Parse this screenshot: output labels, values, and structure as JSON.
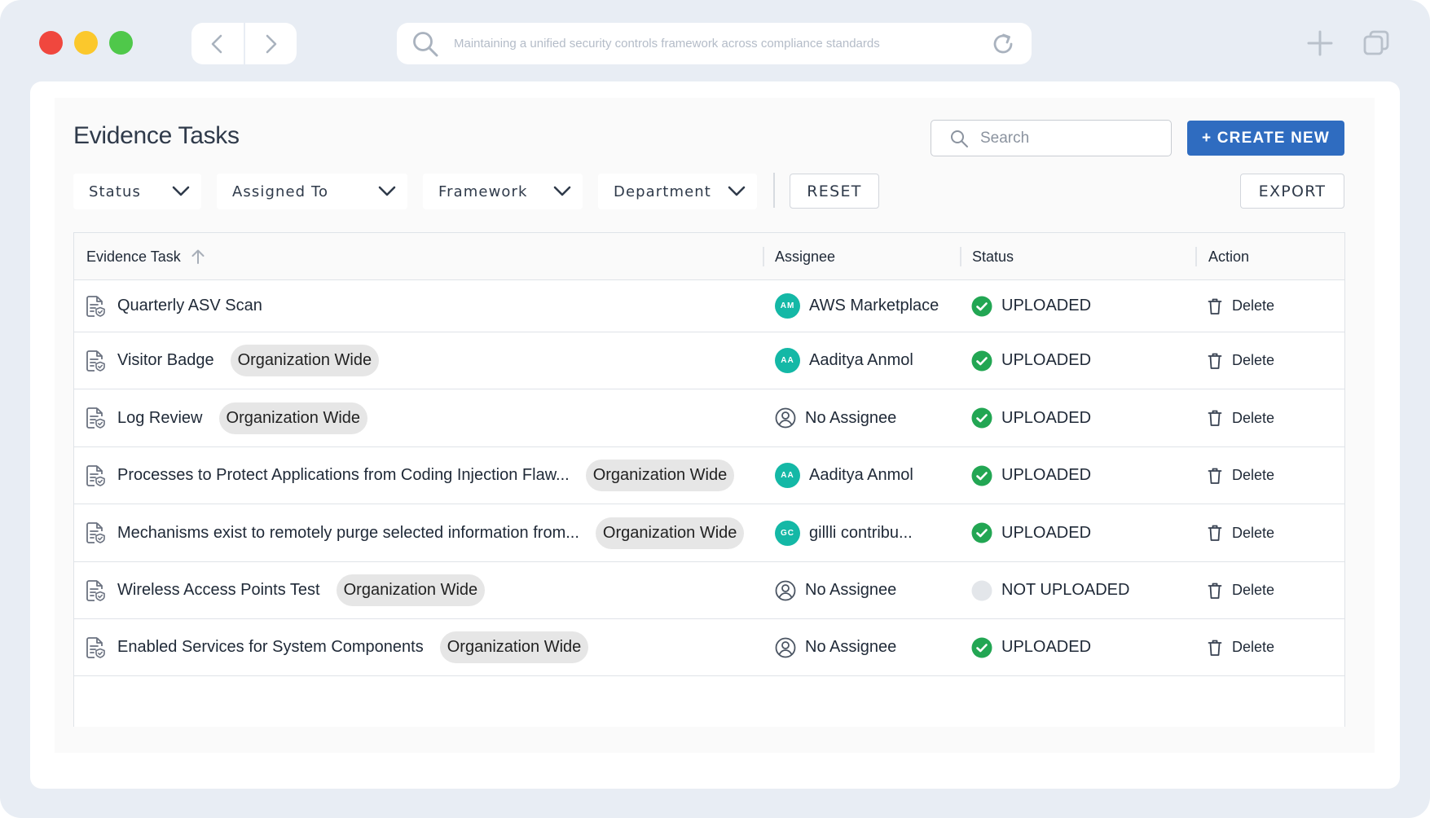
{
  "browser": {
    "url_text": "Maintaining a unified security controls framework across compliance standards",
    "icons": [
      "back-icon",
      "forward-icon",
      "search-icon",
      "reload-icon",
      "new-tab-icon",
      "tabs-icon"
    ]
  },
  "header": {
    "title": "Evidence Tasks",
    "search_placeholder": "Search",
    "create_label": "+ CREATE NEW"
  },
  "filters": {
    "status": "Status",
    "assigned_to": "Assigned To",
    "framework": "Framework",
    "department": "Department",
    "reset": "RESET",
    "export": "EXPORT"
  },
  "table": {
    "columns": {
      "task": "Evidence Task",
      "assignee": "Assignee",
      "status": "Status",
      "action": "Action"
    },
    "rows": [
      {
        "task": "Quarterly ASV Scan",
        "tag": "",
        "assignee": "AWS Marketplace",
        "initials": "AM",
        "status": "UPLOADED",
        "uploaded": true,
        "action": "Delete"
      },
      {
        "task": "Visitor Badge",
        "tag": "Organization Wide",
        "assignee": "Aaditya Anmol",
        "initials": "AA",
        "status": "UPLOADED",
        "uploaded": true,
        "action": "Delete"
      },
      {
        "task": "Log Review",
        "tag": "Organization Wide",
        "assignee": "No Assignee",
        "initials": "",
        "status": "UPLOADED",
        "uploaded": true,
        "action": "Delete"
      },
      {
        "task": "Processes to Protect Applications from Coding Injection Flaw...",
        "tag": "Organization Wide",
        "assignee": "Aaditya Anmol",
        "initials": "AA",
        "status": "UPLOADED",
        "uploaded": true,
        "action": "Delete"
      },
      {
        "task": "Mechanisms exist to remotely purge selected information from...",
        "tag": "Organization Wide",
        "assignee": "gillli contribu...",
        "initials": "GC",
        "status": "UPLOADED",
        "uploaded": true,
        "action": "Delete"
      },
      {
        "task": "Wireless Access Points Test",
        "tag": "Organization Wide",
        "assignee": "No Assignee",
        "initials": "",
        "status": "NOT UPLOADED",
        "uploaded": false,
        "action": "Delete"
      },
      {
        "task": "Enabled Services for System Components",
        "tag": "Organization Wide",
        "assignee": "No Assignee",
        "initials": "",
        "status": "UPLOADED",
        "uploaded": true,
        "action": "Delete"
      }
    ]
  },
  "colors": {
    "primary": "#2f6cc0",
    "avatar": "#14b8a6",
    "uploaded": "#22a653",
    "not_uploaded": "#e3e6ea",
    "window_bg": "#e8edf4"
  }
}
